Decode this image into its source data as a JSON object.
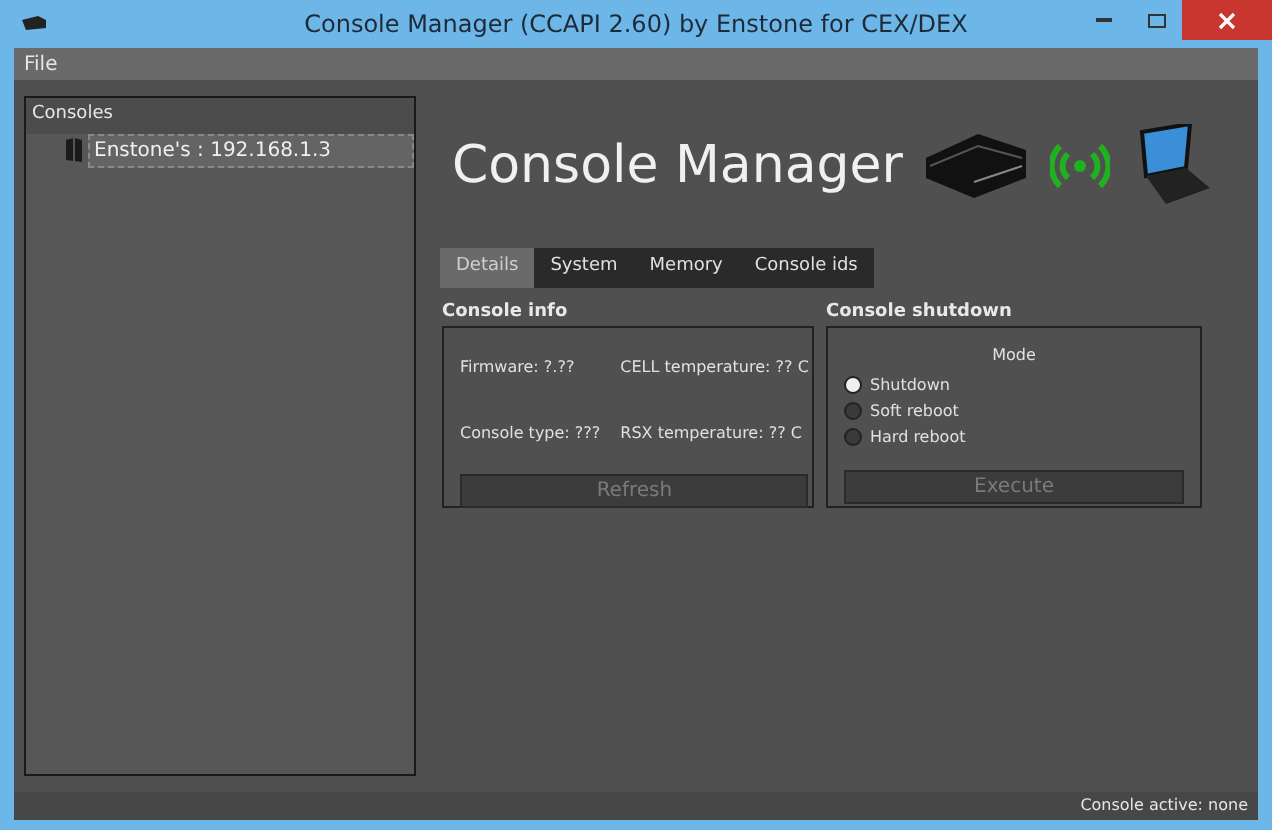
{
  "window": {
    "title": "Console Manager (CCAPI 2.60) by Enstone for CEX/DEX"
  },
  "menu": [
    "File"
  ],
  "consoles": {
    "header": "Consoles",
    "items": [
      {
        "label": "Enstone's : 192.168.1.3",
        "selected": true
      }
    ]
  },
  "banner": {
    "title": "Console Manager"
  },
  "tabs": [
    {
      "label": "Details",
      "selected": true
    },
    {
      "label": "System",
      "selected": false
    },
    {
      "label": "Memory",
      "selected": false
    },
    {
      "label": "Console ids",
      "selected": false
    }
  ],
  "console_info": {
    "title": "Console info",
    "fields": [
      "Firmware: ?.??",
      "CELL temperature: ?? C",
      "Console type: ???",
      "RSX temperature: ?? C"
    ],
    "button": {
      "label": "Refresh",
      "disabled": true
    }
  },
  "console_shutdown": {
    "title": "Console shutdown",
    "mode_label": "Mode",
    "options": [
      {
        "label": "Shutdown",
        "selected": true
      },
      {
        "label": "Soft reboot",
        "selected": false
      },
      {
        "label": "Hard reboot",
        "selected": false
      }
    ],
    "button": {
      "label": "Execute",
      "disabled": true
    }
  },
  "status_bar": "Console active: none"
}
